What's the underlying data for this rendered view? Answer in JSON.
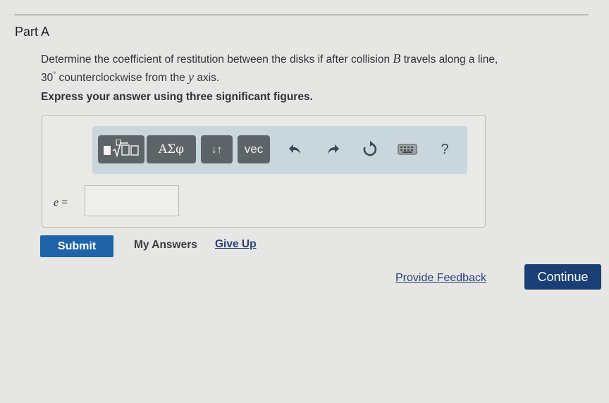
{
  "part": {
    "title": "Part A"
  },
  "question": {
    "text_before_b": "Determine the coefficient of restitution between the disks if after collision ",
    "var_b": "B",
    "text_after_b": " travels along a line,",
    "angle_value": "30",
    "angle_unit": "°",
    "text_before_y": " counterclockwise from the ",
    "var_y": "y",
    "text_after_y": " axis."
  },
  "instruction": "Express your answer using three significant figures.",
  "toolbar": {
    "greek_label": "ΑΣφ",
    "arrows_label": "↓↑",
    "vec_label": "vec",
    "help_label": "?"
  },
  "answer": {
    "variable": "e",
    "equals": " =",
    "value": ""
  },
  "actions": {
    "submit_label": "Submit",
    "my_answers_label": "My Answers",
    "give_up_label": "Give Up"
  },
  "footer": {
    "feedback_label": "Provide Feedback",
    "continue_label": "Continue"
  },
  "colors": {
    "submit": "#1f63a8",
    "continue": "#1a3f75",
    "toolbar_bg": "#c9d6dc",
    "toolbar_button": "#5d6468",
    "link": "#2a3e73"
  },
  "icons": [
    "templates-icon",
    "undo-icon",
    "redo-icon",
    "reset-icon",
    "keyboard-icon",
    "help-icon"
  ]
}
